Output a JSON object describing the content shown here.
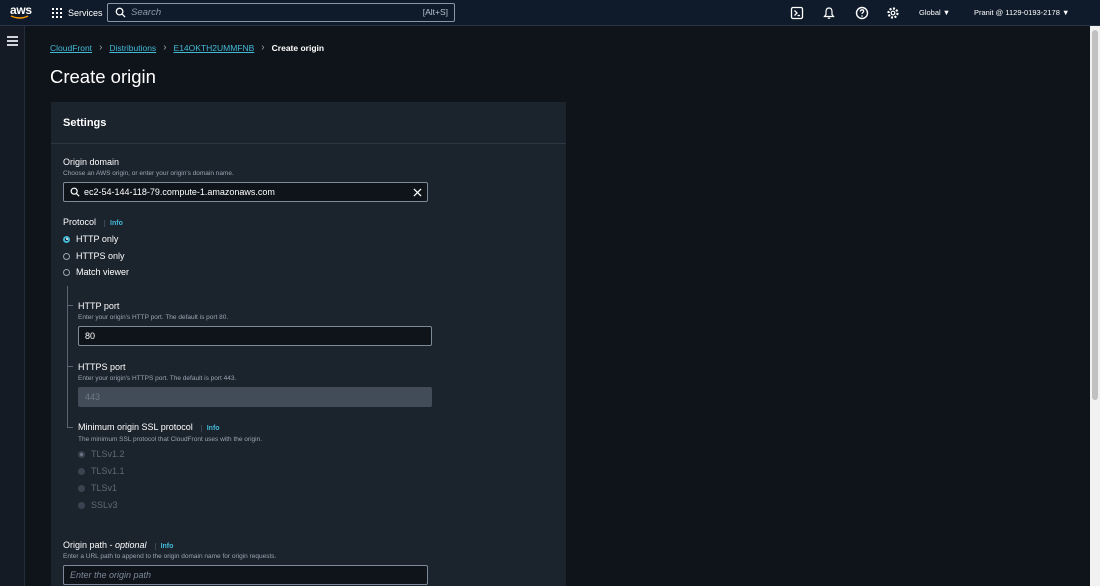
{
  "nav": {
    "logo": "aws",
    "services_label": "Services",
    "search_placeholder": "Search",
    "search_shortcut": "[Alt+S]",
    "region": "Global ▼",
    "account": "Pranit @ 1129-0193-2178 ▼",
    "icons": [
      "cloudshell-icon",
      "notifications-icon",
      "help-icon",
      "settings-icon"
    ]
  },
  "breadcrumb": {
    "items": [
      "CloudFront",
      "Distributions",
      "E14OKTH2UMMFNB"
    ],
    "current": "Create origin"
  },
  "page_title": "Create origin",
  "settings": {
    "title": "Settings",
    "origin_domain": {
      "label": "Origin domain",
      "description": "Choose an AWS origin, or enter your origin's domain name.",
      "value": "ec2-54-144-118-79.compute-1.amazonaws.com"
    },
    "protocol": {
      "label": "Protocol",
      "info": "Info",
      "options": [
        "HTTP only",
        "HTTPS only",
        "Match viewer"
      ],
      "selected": "HTTP only"
    },
    "http_port": {
      "label": "HTTP port",
      "description": "Enter your origin's HTTP port. The default is port 80.",
      "value": "80"
    },
    "https_port": {
      "label": "HTTPS port",
      "description": "Enter your origin's HTTPS port. The default is port 443.",
      "value": "443"
    },
    "ssl_protocol": {
      "label": "Minimum origin SSL protocol",
      "info": "Info",
      "description": "The minimum SSL protocol that CloudFront uses with the origin.",
      "options": [
        "TLSv1.2",
        "TLSv1.1",
        "TLSv1",
        "SSLv3"
      ],
      "selected": "TLSv1.2"
    },
    "origin_path": {
      "label": "Origin path - ",
      "label_optional": "optional",
      "info": "Info",
      "description": "Enter a URL path to append to the origin domain name for origin requests.",
      "placeholder": "Enter the origin path"
    }
  },
  "colors": {
    "accent": "#44b9d6",
    "background": "#0f141a",
    "panel": "#1b232d",
    "nav": "#0f1b2a"
  }
}
